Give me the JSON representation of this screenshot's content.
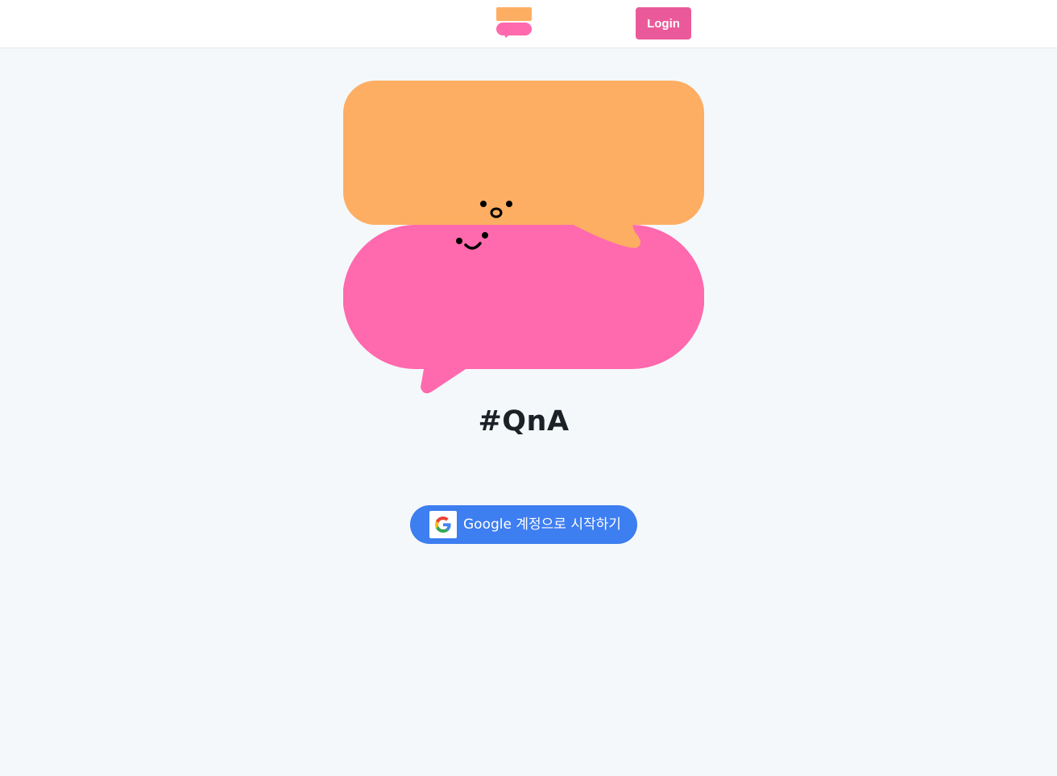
{
  "header": {
    "logo_icon": "speech-bubbles-logo-icon",
    "login_label": "Login"
  },
  "hero": {
    "illustration_icon": "smiling-speech-bubbles-icon",
    "colors": {
      "orange_bubble": "#fdae62",
      "pink_bubble": "#ff69ad",
      "face": "#000000"
    }
  },
  "brand": {
    "title": "#QnA"
  },
  "auth": {
    "google_button_label": "Google 계정으로 시작하기",
    "google_icon": "google-g-icon"
  },
  "colors": {
    "accent_pink": "#ea5a9a",
    "google_blue": "#3d7ef0",
    "background": "#f5f8fb"
  }
}
